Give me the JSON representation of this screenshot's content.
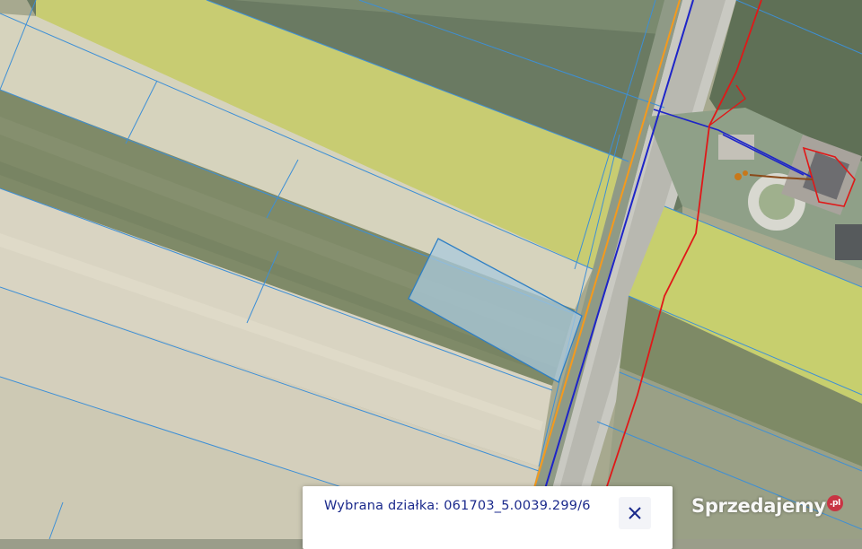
{
  "popup": {
    "label": "Wybrana działka:",
    "parcel_id": "061703_5.0039.299/6"
  },
  "close_icon": "close-icon",
  "watermark": {
    "text": "Sprzedajemy",
    "suffix": ".pl"
  },
  "colors": {
    "parcel_border": "#3d8fd6",
    "selected_parcel_fill": "#a9c9de",
    "utility_blue": "#1d24c8",
    "utility_orange": "#f59a1c",
    "utility_red": "#e01818",
    "popup_text": "#1b2a8c"
  }
}
